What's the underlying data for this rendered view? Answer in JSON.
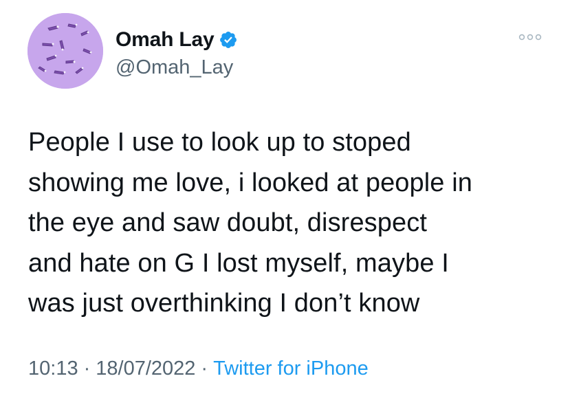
{
  "author": {
    "display_name": "Omah Lay",
    "handle": "@Omah_Lay",
    "verified": true,
    "avatar_bg": "#c7a6ec"
  },
  "tweet": {
    "text": "People I use to look up to stoped\nshowing me love, i looked at people in\nthe eye and saw doubt, disrespect\nand hate on G I lost myself, maybe I\nwas just overthinking I don’t know"
  },
  "meta": {
    "time": "10:13",
    "separator": "·",
    "date": "18/07/2022",
    "source": "Twitter for iPhone"
  },
  "colors": {
    "text": "#0f1419",
    "secondary": "#536471",
    "link": "#1d9bf0",
    "verified": "#1d9bf0"
  },
  "icons": {
    "verified": "verified-badge-icon",
    "more": "more-horizontal-icon"
  }
}
